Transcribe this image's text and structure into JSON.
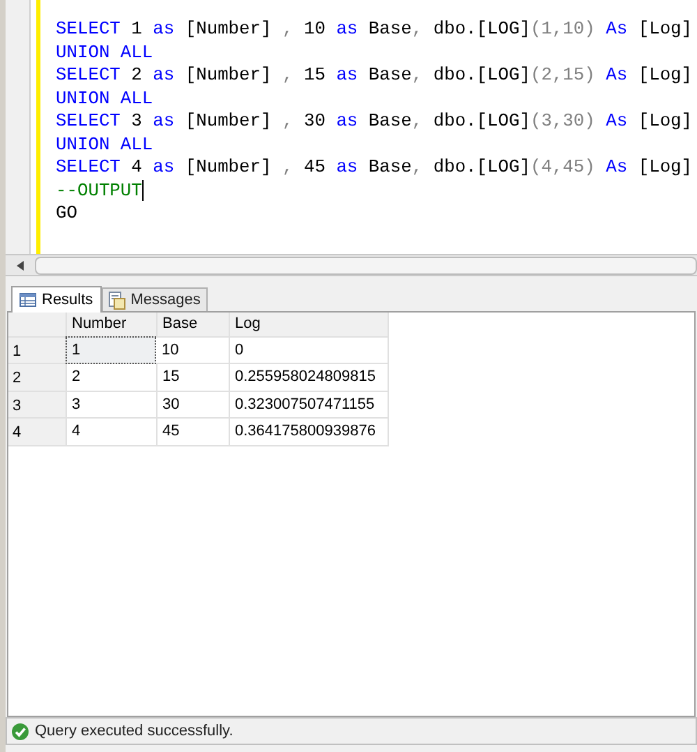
{
  "editor": {
    "lines": [
      [
        {
          "text": "SELECT",
          "kind": "keyword"
        },
        {
          "text": " 1 ",
          "kind": "plain"
        },
        {
          "text": "as",
          "kind": "keyword"
        },
        {
          "text": " [Number] ",
          "kind": "plain"
        },
        {
          "text": ",",
          "kind": "operator"
        },
        {
          "text": " 10 ",
          "kind": "plain"
        },
        {
          "text": "as",
          "kind": "keyword"
        },
        {
          "text": " Base",
          "kind": "plain"
        },
        {
          "text": ",",
          "kind": "operator"
        },
        {
          "text": " dbo.[LOG]",
          "kind": "plain"
        },
        {
          "text": "(1,10) ",
          "kind": "operator"
        },
        {
          "text": "As",
          "kind": "keyword"
        },
        {
          "text": " [Log]",
          "kind": "plain"
        }
      ],
      [
        {
          "text": "UNION ALL",
          "kind": "keyword"
        }
      ],
      [
        {
          "text": "SELECT",
          "kind": "keyword"
        },
        {
          "text": " 2 ",
          "kind": "plain"
        },
        {
          "text": "as",
          "kind": "keyword"
        },
        {
          "text": " [Number] ",
          "kind": "plain"
        },
        {
          "text": ",",
          "kind": "operator"
        },
        {
          "text": " 15 ",
          "kind": "plain"
        },
        {
          "text": "as",
          "kind": "keyword"
        },
        {
          "text": " Base",
          "kind": "plain"
        },
        {
          "text": ",",
          "kind": "operator"
        },
        {
          "text": " dbo.[LOG]",
          "kind": "plain"
        },
        {
          "text": "(2,15) ",
          "kind": "operator"
        },
        {
          "text": "As",
          "kind": "keyword"
        },
        {
          "text": " [Log]",
          "kind": "plain"
        }
      ],
      [
        {
          "text": "UNION ALL",
          "kind": "keyword"
        }
      ],
      [
        {
          "text": "SELECT",
          "kind": "keyword"
        },
        {
          "text": " 3 ",
          "kind": "plain"
        },
        {
          "text": "as",
          "kind": "keyword"
        },
        {
          "text": " [Number] ",
          "kind": "plain"
        },
        {
          "text": ",",
          "kind": "operator"
        },
        {
          "text": " 30 ",
          "kind": "plain"
        },
        {
          "text": "as",
          "kind": "keyword"
        },
        {
          "text": " Base",
          "kind": "plain"
        },
        {
          "text": ",",
          "kind": "operator"
        },
        {
          "text": " dbo.[LOG]",
          "kind": "plain"
        },
        {
          "text": "(3,30) ",
          "kind": "operator"
        },
        {
          "text": "As",
          "kind": "keyword"
        },
        {
          "text": " [Log]",
          "kind": "plain"
        }
      ],
      [
        {
          "text": "UNION ALL",
          "kind": "keyword"
        }
      ],
      [
        {
          "text": "SELECT",
          "kind": "keyword"
        },
        {
          "text": " 4 ",
          "kind": "plain"
        },
        {
          "text": "as",
          "kind": "keyword"
        },
        {
          "text": " [Number] ",
          "kind": "plain"
        },
        {
          "text": ",",
          "kind": "operator"
        },
        {
          "text": " 45 ",
          "kind": "plain"
        },
        {
          "text": "as",
          "kind": "keyword"
        },
        {
          "text": " Base",
          "kind": "plain"
        },
        {
          "text": ",",
          "kind": "operator"
        },
        {
          "text": " dbo.[LOG]",
          "kind": "plain"
        },
        {
          "text": "(4,45) ",
          "kind": "operator"
        },
        {
          "text": "As",
          "kind": "keyword"
        },
        {
          "text": " [Log]",
          "kind": "plain"
        }
      ],
      [
        {
          "text": "--OUTPUT",
          "kind": "comment"
        }
      ],
      [
        {
          "text": "GO",
          "kind": "plain"
        }
      ]
    ]
  },
  "tabs": [
    {
      "label": "Results",
      "selected": true,
      "kind": "grid"
    },
    {
      "label": "Messages",
      "selected": false,
      "kind": "messages"
    }
  ],
  "table": {
    "columns": [
      "Number",
      "Base",
      "Log"
    ],
    "rows": [
      {
        "number": "1",
        "cells": [
          {
            "text": "1",
            "selected": true
          },
          {
            "text": "10",
            "selected": false
          },
          {
            "text": "0",
            "selected": false
          }
        ]
      },
      {
        "number": "2",
        "cells": [
          {
            "text": "2",
            "selected": false
          },
          {
            "text": "15",
            "selected": false
          },
          {
            "text": "0.255958024809815",
            "selected": false
          }
        ]
      },
      {
        "number": "3",
        "cells": [
          {
            "text": "3",
            "selected": false
          },
          {
            "text": "30",
            "selected": false
          },
          {
            "text": "0.323007507471155",
            "selected": false
          }
        ]
      },
      {
        "number": "4",
        "cells": [
          {
            "text": "4",
            "selected": false
          },
          {
            "text": "45",
            "selected": false
          },
          {
            "text": "0.364175800939876",
            "selected": false
          }
        ]
      }
    ]
  },
  "status_bar": {
    "message": "Query executed successfully."
  }
}
